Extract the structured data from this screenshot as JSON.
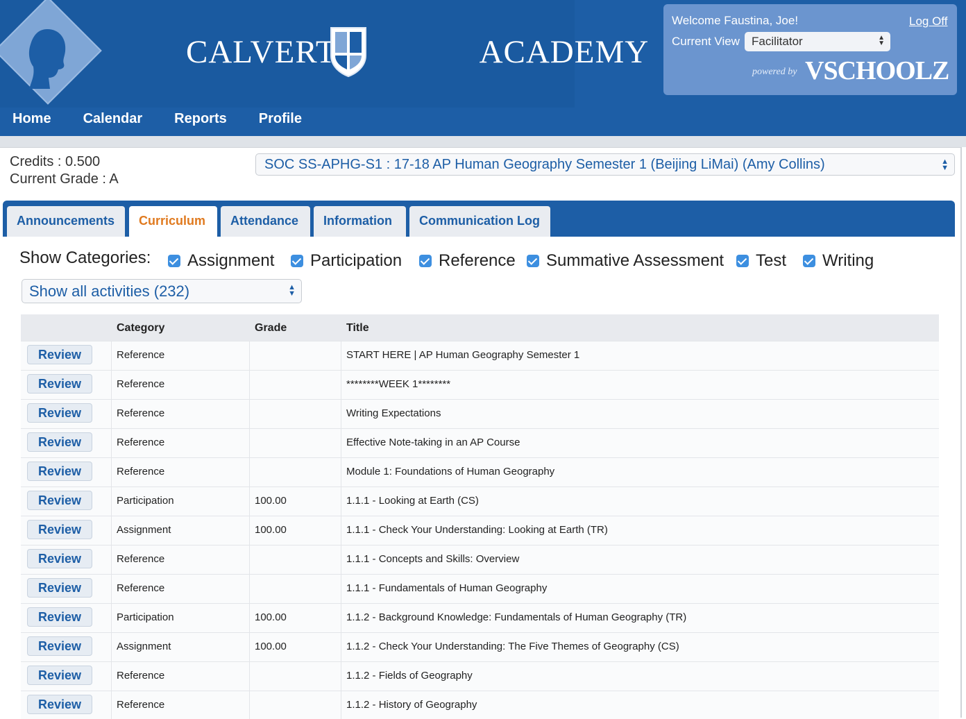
{
  "brand": {
    "left": "CALVERT",
    "right": "ACADEMY"
  },
  "welcome": {
    "text": "Welcome Faustina, Joe!",
    "logoff": "Log Off",
    "current_view_label": "Current View",
    "current_view_value": "Facilitator",
    "powered_by": "powered by",
    "vendor": "VSCHOOLZ"
  },
  "nav": {
    "items": [
      "Home",
      "Calendar",
      "Reports",
      "Profile"
    ]
  },
  "student": {
    "credits": "Credits : 0.500",
    "grade": "Current Grade : A"
  },
  "course": {
    "selected": "SOC  SS-APHG-S1 : 17-18 AP Human Geography Semester 1 (Beijing LiMai)  (Amy Collins)"
  },
  "tabs": [
    "Announcements",
    "Curriculum",
    "Attendance",
    "Information",
    "Communication Log"
  ],
  "active_tab": "Curriculum",
  "categories": {
    "label": "Show Categories:",
    "items": [
      "Assignment",
      "Participation",
      "Reference",
      "Summative Assessment",
      "Test",
      "Writing"
    ]
  },
  "activities_filter": "Show all activities (232)",
  "table": {
    "headers": {
      "category": "Category",
      "grade": "Grade",
      "title": "Title"
    },
    "review_label": "Review",
    "rows": [
      {
        "category": "Reference",
        "grade": "",
        "title": "START HERE | AP Human Geography Semester 1"
      },
      {
        "category": "Reference",
        "grade": "",
        "title": "********WEEK 1********"
      },
      {
        "category": "Reference",
        "grade": "",
        "title": "Writing Expectations"
      },
      {
        "category": "Reference",
        "grade": "",
        "title": "Effective Note-taking in an AP Course"
      },
      {
        "category": "Reference",
        "grade": "",
        "title": "Module 1: Foundations of Human Geography"
      },
      {
        "category": "Participation",
        "grade": "100.00",
        "title": "1.1.1 - Looking at Earth (CS)"
      },
      {
        "category": "Assignment",
        "grade": "100.00",
        "title": "1.1.1 - Check Your Understanding: Looking at Earth (TR)"
      },
      {
        "category": "Reference",
        "grade": "",
        "title": "1.1.1 - Concepts and Skills: Overview"
      },
      {
        "category": "Reference",
        "grade": "",
        "title": "1.1.1 - Fundamentals of Human Geography"
      },
      {
        "category": "Participation",
        "grade": "100.00",
        "title": "1.1.2 - Background Knowledge: Fundamentals of Human Geography (TR)"
      },
      {
        "category": "Assignment",
        "grade": "100.00",
        "title": "1.1.2 - Check Your Understanding: The Five Themes of Geography (CS)"
      },
      {
        "category": "Reference",
        "grade": "",
        "title": "1.1.2 - Fields of Geography"
      },
      {
        "category": "Reference",
        "grade": "",
        "title": "1.1.2 - History of Geography"
      }
    ]
  }
}
